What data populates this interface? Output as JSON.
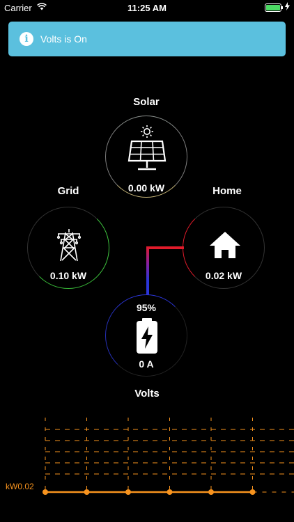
{
  "status_bar": {
    "carrier": "Carrier",
    "time": "11:25 AM"
  },
  "banner": {
    "message": "Volts is On",
    "icon": "info-icon",
    "color": "#5bc0de"
  },
  "nodes": {
    "solar": {
      "label": "Solar",
      "value": "0.00 kW",
      "icon": "solar-panel-icon"
    },
    "grid": {
      "label": "Grid",
      "value": "0.10 kW",
      "icon": "power-tower-icon"
    },
    "home": {
      "label": "Home",
      "value": "0.02 kW",
      "icon": "home-icon"
    },
    "volts": {
      "label": "Volts",
      "value": "0 A",
      "charge": "95%",
      "icon": "battery-charging-icon"
    }
  },
  "colors": {
    "accent": "#f7931e",
    "grid": "#3ec43e",
    "home": "#e01b2a",
    "battery": "#2b35d8"
  },
  "chart_data": {
    "type": "line",
    "ytick": "kW0.02",
    "x": [
      1,
      2,
      3,
      4,
      5,
      6
    ],
    "values": [
      0.02,
      0.02,
      0.02,
      0.02,
      0.02,
      0.02
    ]
  }
}
